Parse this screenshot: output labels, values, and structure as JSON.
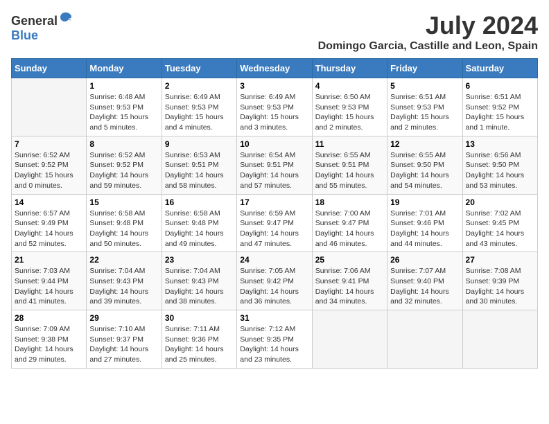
{
  "header": {
    "logo_general": "General",
    "logo_blue": "Blue",
    "month_title": "July 2024",
    "location": "Domingo Garcia, Castille and Leon, Spain"
  },
  "days_of_week": [
    "Sunday",
    "Monday",
    "Tuesday",
    "Wednesday",
    "Thursday",
    "Friday",
    "Saturday"
  ],
  "weeks": [
    [
      {
        "day": "",
        "info": ""
      },
      {
        "day": "1",
        "info": "Sunrise: 6:48 AM\nSunset: 9:53 PM\nDaylight: 15 hours\nand 5 minutes."
      },
      {
        "day": "2",
        "info": "Sunrise: 6:49 AM\nSunset: 9:53 PM\nDaylight: 15 hours\nand 4 minutes."
      },
      {
        "day": "3",
        "info": "Sunrise: 6:49 AM\nSunset: 9:53 PM\nDaylight: 15 hours\nand 3 minutes."
      },
      {
        "day": "4",
        "info": "Sunrise: 6:50 AM\nSunset: 9:53 PM\nDaylight: 15 hours\nand 2 minutes."
      },
      {
        "day": "5",
        "info": "Sunrise: 6:51 AM\nSunset: 9:53 PM\nDaylight: 15 hours\nand 2 minutes."
      },
      {
        "day": "6",
        "info": "Sunrise: 6:51 AM\nSunset: 9:52 PM\nDaylight: 15 hours\nand 1 minute."
      }
    ],
    [
      {
        "day": "7",
        "info": "Sunrise: 6:52 AM\nSunset: 9:52 PM\nDaylight: 15 hours\nand 0 minutes."
      },
      {
        "day": "8",
        "info": "Sunrise: 6:52 AM\nSunset: 9:52 PM\nDaylight: 14 hours\nand 59 minutes."
      },
      {
        "day": "9",
        "info": "Sunrise: 6:53 AM\nSunset: 9:51 PM\nDaylight: 14 hours\nand 58 minutes."
      },
      {
        "day": "10",
        "info": "Sunrise: 6:54 AM\nSunset: 9:51 PM\nDaylight: 14 hours\nand 57 minutes."
      },
      {
        "day": "11",
        "info": "Sunrise: 6:55 AM\nSunset: 9:51 PM\nDaylight: 14 hours\nand 55 minutes."
      },
      {
        "day": "12",
        "info": "Sunrise: 6:55 AM\nSunset: 9:50 PM\nDaylight: 14 hours\nand 54 minutes."
      },
      {
        "day": "13",
        "info": "Sunrise: 6:56 AM\nSunset: 9:50 PM\nDaylight: 14 hours\nand 53 minutes."
      }
    ],
    [
      {
        "day": "14",
        "info": "Sunrise: 6:57 AM\nSunset: 9:49 PM\nDaylight: 14 hours\nand 52 minutes."
      },
      {
        "day": "15",
        "info": "Sunrise: 6:58 AM\nSunset: 9:48 PM\nDaylight: 14 hours\nand 50 minutes."
      },
      {
        "day": "16",
        "info": "Sunrise: 6:58 AM\nSunset: 9:48 PM\nDaylight: 14 hours\nand 49 minutes."
      },
      {
        "day": "17",
        "info": "Sunrise: 6:59 AM\nSunset: 9:47 PM\nDaylight: 14 hours\nand 47 minutes."
      },
      {
        "day": "18",
        "info": "Sunrise: 7:00 AM\nSunset: 9:47 PM\nDaylight: 14 hours\nand 46 minutes."
      },
      {
        "day": "19",
        "info": "Sunrise: 7:01 AM\nSunset: 9:46 PM\nDaylight: 14 hours\nand 44 minutes."
      },
      {
        "day": "20",
        "info": "Sunrise: 7:02 AM\nSunset: 9:45 PM\nDaylight: 14 hours\nand 43 minutes."
      }
    ],
    [
      {
        "day": "21",
        "info": "Sunrise: 7:03 AM\nSunset: 9:44 PM\nDaylight: 14 hours\nand 41 minutes."
      },
      {
        "day": "22",
        "info": "Sunrise: 7:04 AM\nSunset: 9:43 PM\nDaylight: 14 hours\nand 39 minutes."
      },
      {
        "day": "23",
        "info": "Sunrise: 7:04 AM\nSunset: 9:43 PM\nDaylight: 14 hours\nand 38 minutes."
      },
      {
        "day": "24",
        "info": "Sunrise: 7:05 AM\nSunset: 9:42 PM\nDaylight: 14 hours\nand 36 minutes."
      },
      {
        "day": "25",
        "info": "Sunrise: 7:06 AM\nSunset: 9:41 PM\nDaylight: 14 hours\nand 34 minutes."
      },
      {
        "day": "26",
        "info": "Sunrise: 7:07 AM\nSunset: 9:40 PM\nDaylight: 14 hours\nand 32 minutes."
      },
      {
        "day": "27",
        "info": "Sunrise: 7:08 AM\nSunset: 9:39 PM\nDaylight: 14 hours\nand 30 minutes."
      }
    ],
    [
      {
        "day": "28",
        "info": "Sunrise: 7:09 AM\nSunset: 9:38 PM\nDaylight: 14 hours\nand 29 minutes."
      },
      {
        "day": "29",
        "info": "Sunrise: 7:10 AM\nSunset: 9:37 PM\nDaylight: 14 hours\nand 27 minutes."
      },
      {
        "day": "30",
        "info": "Sunrise: 7:11 AM\nSunset: 9:36 PM\nDaylight: 14 hours\nand 25 minutes."
      },
      {
        "day": "31",
        "info": "Sunrise: 7:12 AM\nSunset: 9:35 PM\nDaylight: 14 hours\nand 23 minutes."
      },
      {
        "day": "",
        "info": ""
      },
      {
        "day": "",
        "info": ""
      },
      {
        "day": "",
        "info": ""
      }
    ]
  ]
}
